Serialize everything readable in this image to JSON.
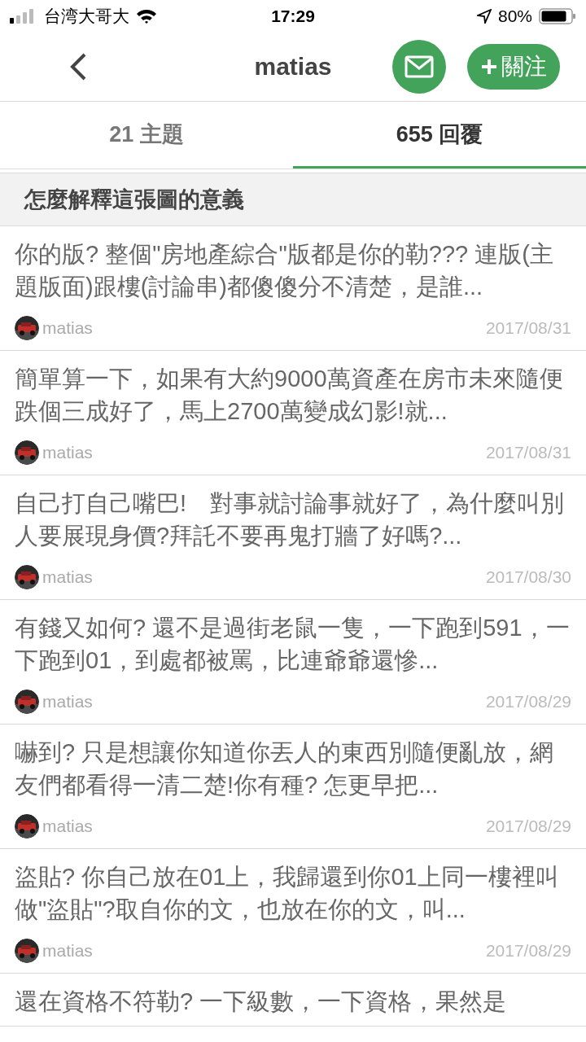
{
  "status_bar": {
    "carrier": "台湾大哥大",
    "time": "17:29",
    "battery": "80%"
  },
  "header": {
    "title": "matias",
    "follow_button": "關注"
  },
  "tabs": [
    {
      "label": "21 主題",
      "selected": false
    },
    {
      "label": "655 回覆",
      "selected": true
    }
  ],
  "section": {
    "title": "怎麼解釋這張圖的意義"
  },
  "posts": [
    {
      "text": "你的版? 整個\"房地產綜合\"版都是你的勒??? 連版(主題版面)跟樓(討論串)都傻傻分不清楚，是誰...",
      "author": "matias",
      "date": "2017/08/31"
    },
    {
      "text": "簡單算一下，如果有大約9000萬資產在房市未來隨便跌個三成好了，馬上2700萬變成幻影!就...",
      "author": "matias",
      "date": "2017/08/31"
    },
    {
      "text": "自己打自己嘴巴!　對事就討論事就好了，為什麼叫別人要展現身價?拜託不要再鬼打牆了好嗎?...",
      "author": "matias",
      "date": "2017/08/30"
    },
    {
      "text": "有錢又如何? 還不是過街老鼠一隻，一下跑到591，一下跑到01，到處都被罵，比連爺爺還慘...",
      "author": "matias",
      "date": "2017/08/29"
    },
    {
      "text": "嚇到? 只是想讓你知道你丟人的東西別隨便亂放，網友們都看得一清二楚!你有種? 怎更早把...",
      "author": "matias",
      "date": "2017/08/29"
    },
    {
      "text": "盜貼?  你自己放在01上，我歸還到你01上同一樓裡叫做\"盜貼\"?取自你的文，也放在你的文，叫...",
      "author": "matias",
      "date": "2017/08/29"
    },
    {
      "text": "還在資格不符勒? 一下級數，一下資格，果然是"
    }
  ]
}
